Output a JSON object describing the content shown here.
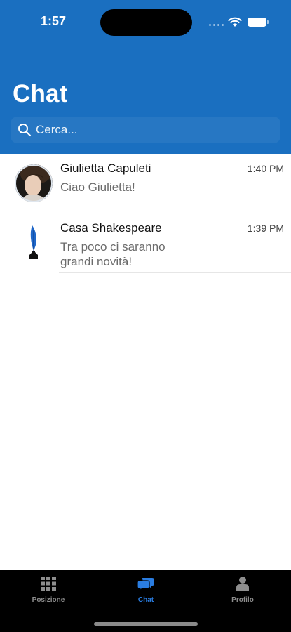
{
  "status_bar": {
    "time": "1:57"
  },
  "header": {
    "title": "Chat",
    "search_placeholder": "Cerca..."
  },
  "chats": [
    {
      "name": "Giulietta Capuleti",
      "preview": "Ciao Giulietta!",
      "time": "1:40 PM",
      "avatar_icon": "portrait-icon"
    },
    {
      "name": "Casa Shakespeare",
      "preview": "Tra poco ci saranno grandi novità!",
      "time": "1:39 PM",
      "avatar_icon": "quill-icon"
    }
  ],
  "tabbar": {
    "tabs": [
      {
        "label": "Posizione",
        "icon": "grid-icon",
        "active": false
      },
      {
        "label": "Chat",
        "icon": "chat-bubbles-icon",
        "active": true
      },
      {
        "label": "Profilo",
        "icon": "person-icon",
        "active": false
      }
    ]
  },
  "colors": {
    "header_bg": "#1a6fc0",
    "active_tab": "#2a7de1",
    "tabbar_bg": "#000000"
  }
}
